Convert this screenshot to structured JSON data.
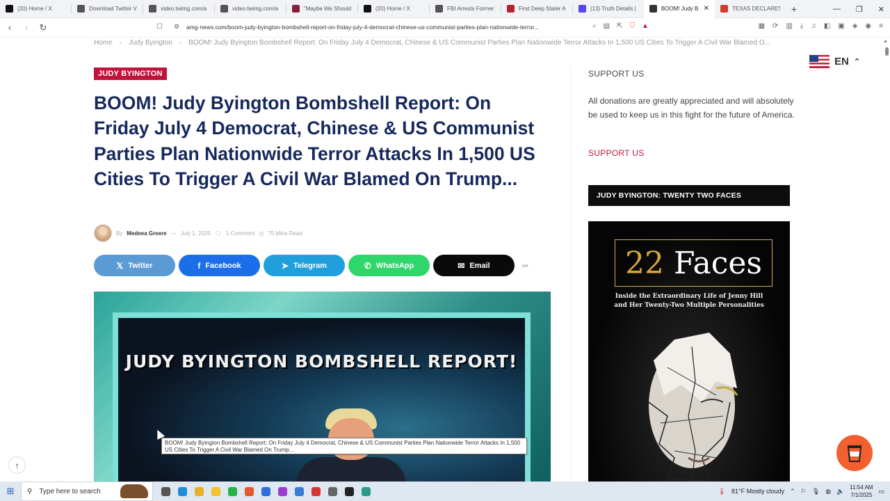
{
  "browser": {
    "tabs": [
      {
        "title": "(20) Home / X",
        "icon": "x-logo-icon",
        "color": "#111111"
      },
      {
        "title": "Download Twitter V",
        "icon": "globe-icon",
        "color": "#555555"
      },
      {
        "title": "video.twimg.com/a",
        "icon": "globe-icon",
        "color": "#555555"
      },
      {
        "title": "video.twimg.com/a",
        "icon": "globe-icon",
        "color": "#555555"
      },
      {
        "title": "\"Maybe We Should",
        "icon": "gp-icon",
        "color": "#8a1f3d"
      },
      {
        "title": "(20) Home / X",
        "icon": "x-logo-icon",
        "color": "#111111"
      },
      {
        "title": "FBI Arrests Former",
        "icon": "globe-icon",
        "color": "#555555"
      },
      {
        "title": "First Deep Stater A",
        "icon": "flag-site-icon",
        "color": "#b2222f"
      },
      {
        "title": "(13) Truth Details |",
        "icon": "truth-social-icon",
        "color": "#5448ee"
      },
      {
        "title": "BOOM! Judy B",
        "icon": "amg-news-icon",
        "color": "#333333",
        "active": true
      },
      {
        "title": "TEXAS DECLARES V",
        "icon": "red-site-icon",
        "color": "#d33a2c"
      }
    ],
    "new_tab": "+",
    "window_controls": {
      "minimize": "—",
      "restore": "❐",
      "close": "✕"
    },
    "url": "amg-news.com/boom-judy-byington-bombshell-report-on-friday-july-4-democrat-chinese-us-communist-parties-plan-nationwide-terror..."
  },
  "breadcrumb": {
    "home": "Home",
    "category": "Judy Byington",
    "current": "BOOM! Judy Byington Bombshell Report: On Friday July 4 Democrat, Chinese & US Communist Parties Plan Nationwide Terror Attacks In 1,500 US Cities To Trigger A Civil War Blamed O..."
  },
  "article": {
    "category": "JUDY BYINGTON",
    "title": "BOOM! Judy Byington Bombshell Report: On Friday July 4 Democrat, Chinese & US Communist Parties Plan Nationwide Terror Attacks In 1,500 US Cities To Trigger A Civil War Blamed On Trump...",
    "meta": {
      "by": "By",
      "author": "Medeea Greere",
      "date": "July 1, 2025",
      "comments": "1 Comment",
      "read_time": "75 Mins Read"
    },
    "share_buttons": [
      {
        "label": "Twitter",
        "icon": "x-logo-icon",
        "glyph": "𝕏",
        "color": "#5b9bd5"
      },
      {
        "label": "Facebook",
        "icon": "facebook-icon",
        "glyph": "f",
        "color": "#1c6ee8"
      },
      {
        "label": "Telegram",
        "icon": "telegram-icon",
        "glyph": "➤",
        "color": "#1f9fdb"
      },
      {
        "label": "WhatsApp",
        "icon": "whatsapp-icon",
        "glyph": "✆",
        "color": "#2fd66a"
      },
      {
        "label": "Email",
        "icon": "envelope-icon",
        "glyph": "✉",
        "color": "#0a0a0a"
      }
    ],
    "hero_text": "JUDY BYINGTON BOMBSHELL REPORT!"
  },
  "sidebar": {
    "support_heading": "SUPPORT US",
    "support_text": "All donations are greatly appreciated and will absolutely be used to keep us in this fight for the future of America.",
    "support_link": "SUPPORT US",
    "widget_heading": "JUDY BYINGTON: TWENTY TWO FACES",
    "book": {
      "title_number": "22",
      "title_word": "Faces",
      "subtitle_line1": "Inside the Extraordinary Life of Jenny Hill",
      "subtitle_line2": "and Her Twenty-Two Multiple Personalities"
    }
  },
  "language": {
    "code": "EN",
    "flag_icon": "us-flag-icon"
  },
  "tooltip": "BOOM! Judy Byington Bombshell Report: On Friday July 4 Democrat, Chinese & US Communist Parties Plan Nationwide Terror Attacks In 1,500 US Cities To Trigger A Civil War Blamed On Trump...",
  "taskbar": {
    "search_placeholder": "Type here to search",
    "weather": "81°F  Mostly cloudy",
    "time": "11:54 AM",
    "date": "7/1/2025"
  },
  "colors": {
    "accent": "#c0143c",
    "headline": "#16285c",
    "coffee_button": "#f1602e"
  }
}
